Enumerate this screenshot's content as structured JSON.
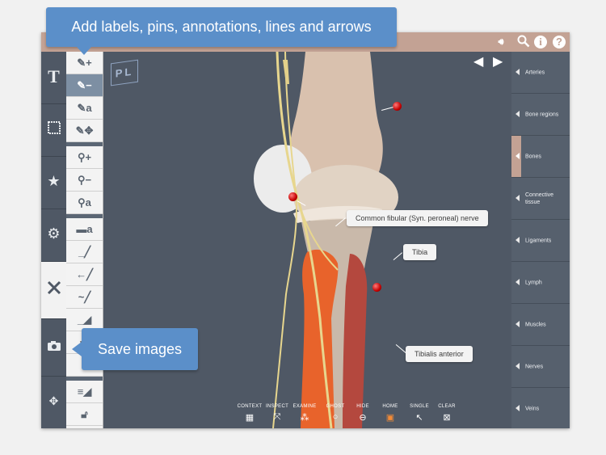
{
  "callouts": {
    "annotate": "Add labels, pins, annotations, lines and arrows",
    "save": "Save images"
  },
  "logo": "PL",
  "labels": [
    "Common fibular (Syn. peroneal) nerve",
    "Tibia",
    "Tibialis anterior"
  ],
  "bottom_toolbar": [
    {
      "label": "CONTEXT",
      "icon": "context-icon"
    },
    {
      "label": "INSPECT",
      "icon": "inspect-icon"
    },
    {
      "label": "EXAMINE",
      "icon": "examine-icon"
    },
    {
      "label": "GHOST",
      "icon": "ghost-icon"
    },
    {
      "label": "HIDE",
      "icon": "hide-icon"
    },
    {
      "label": "HOME",
      "icon": "home-icon"
    },
    {
      "label": "SINGLE",
      "icon": "single-icon"
    },
    {
      "label": "CLEAR",
      "icon": "clear-icon"
    }
  ],
  "layers": [
    {
      "label": "Arteries"
    },
    {
      "label": "Bone regions"
    },
    {
      "label": "Bones",
      "active": true
    },
    {
      "label": "Connective tissue"
    },
    {
      "label": "Ligaments"
    },
    {
      "label": "Lymph"
    },
    {
      "label": "Muscles"
    },
    {
      "label": "Nerves"
    },
    {
      "label": "Veins"
    }
  ],
  "left_panel": {
    "text_glyph": "T",
    "buttons": [
      "text-icon",
      "frame-icon",
      "star-icon",
      "gear-icon",
      "annotate-tools-icon",
      "camera-icon",
      "move-icon"
    ],
    "active": "annotate-tools-icon"
  },
  "colors": {
    "topbar": "#c3a294",
    "callout": "#5b8fc9",
    "viewport_bg": "#4f5865",
    "home_accent": "#f38b36"
  }
}
